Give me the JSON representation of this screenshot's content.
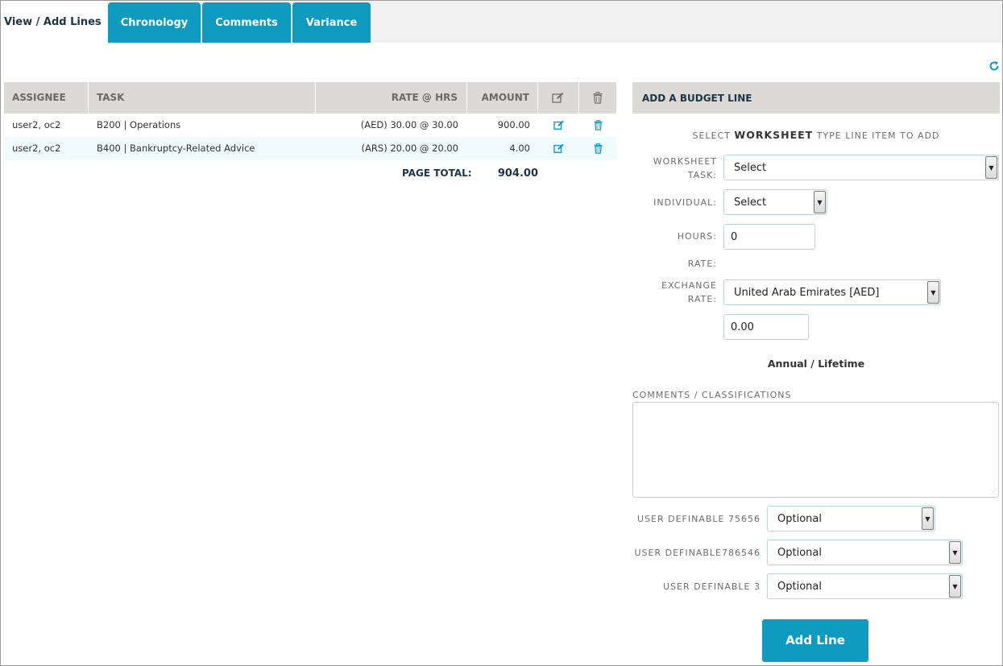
{
  "tabs": [
    {
      "label": "View / Add Lines",
      "active": true
    },
    {
      "label": "Chronology"
    },
    {
      "label": "Comments"
    },
    {
      "label": "Variance"
    }
  ],
  "grid": {
    "headers": {
      "assignee": "ASSIGNEE",
      "task": "TASK",
      "rate_hrs": "RATE @ HRS",
      "amount": "AMOUNT"
    },
    "rows": [
      {
        "assignee": "user2, oc2",
        "task": "B200 | Operations",
        "rate_hrs": "(AED) 30.00 @ 30.00",
        "amount": "900.00"
      },
      {
        "assignee": "user2, oc2",
        "task": "B400 | Bankruptcy-Related Advice",
        "rate_hrs": "(ARS) 20.00 @ 20.00",
        "amount": "4.00"
      }
    ],
    "page_total_label": "PAGE TOTAL:",
    "page_total_value": "904.00"
  },
  "form": {
    "title": "ADD A BUDGET LINE",
    "instruction_pre": "SELECT ",
    "instruction_bold": "WORKSHEET",
    "instruction_post": " TYPE LINE ITEM TO ADD",
    "worksheet_task_label_1": "WORKSHEET",
    "worksheet_task_label_2": "TASK:",
    "worksheet_task_value": "Select",
    "individual_label": "INDIVIDUAL:",
    "individual_value": "Select",
    "hours_label": "HOURS:",
    "hours_value": "0",
    "rate_label": "RATE:",
    "exchange_rate_label_1": "EXCHANGE",
    "exchange_rate_label_2": "RATE:",
    "exchange_rate_value": "United Arab Emirates [AED]",
    "exchange_rate_amount": "0.00",
    "annual_lifetime": "Annual / Lifetime",
    "comments_label": "COMMENTS / CLASSIFICATIONS",
    "comments_value": "",
    "user_definables": [
      {
        "label": "USER DEFINABLE 75656",
        "value": "Optional"
      },
      {
        "label": "USER DEFINABLE786546",
        "value": "Optional"
      },
      {
        "label": "USER DEFINABLE 3",
        "value": "Optional"
      }
    ],
    "add_button": "Add Line"
  },
  "colors": {
    "accent": "#0e9bbf",
    "header_bg": "#dcdad6",
    "alt_row": "#effbfd",
    "dark_text": "#1d3447"
  }
}
